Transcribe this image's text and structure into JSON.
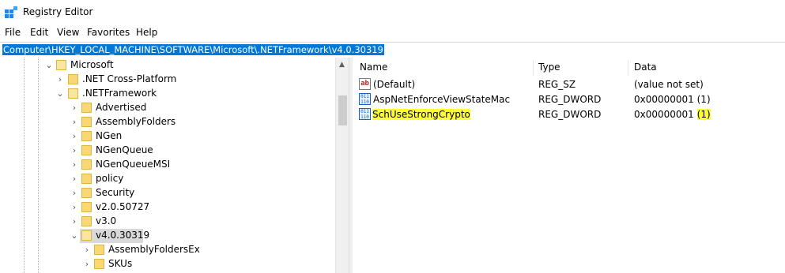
{
  "window": {
    "title": "Registry Editor",
    "icon": "registry-editor-icon"
  },
  "menu": {
    "items": [
      "File",
      "Edit",
      "View",
      "Favorites",
      "Help"
    ]
  },
  "address": {
    "path": "Computer\\HKEY_LOCAL_MACHINE\\SOFTWARE\\Microsoft\\.NETFramework\\v4.0.30319"
  },
  "tree": {
    "nodes": [
      {
        "label": "Microsoft",
        "state": "expanded"
      },
      {
        "label": ".NET Cross-Platform",
        "state": "collapsed"
      },
      {
        "label": ".NETFramework",
        "state": "expanded"
      },
      {
        "label": "Advertised",
        "state": "collapsed"
      },
      {
        "label": "AssemblyFolders",
        "state": "collapsed"
      },
      {
        "label": "NGen",
        "state": "collapsed"
      },
      {
        "label": "NGenQueue",
        "state": "collapsed"
      },
      {
        "label": "NGenQueueMSI",
        "state": "collapsed"
      },
      {
        "label": "policy",
        "state": "collapsed"
      },
      {
        "label": "Security",
        "state": "collapsed"
      },
      {
        "label": "v2.0.50727",
        "state": "collapsed"
      },
      {
        "label": "v3.0",
        "state": "collapsed"
      },
      {
        "label": "v4.0.30319",
        "state": "expanded",
        "selected": true
      },
      {
        "label": "AssemblyFoldersEx",
        "state": "collapsed"
      },
      {
        "label": "SKUs",
        "state": "collapsed"
      }
    ]
  },
  "list": {
    "columns": [
      "Name",
      "Type",
      "Data"
    ],
    "rows": [
      {
        "icon": "string-value-icon",
        "name": "(Default)",
        "type": "REG_SZ",
        "data": "(value not set)",
        "highlighted": false
      },
      {
        "icon": "dword-value-icon",
        "name": "AspNetEnforceViewStateMac",
        "type": "REG_DWORD",
        "data": "0x00000001 (1)",
        "highlighted": false
      },
      {
        "icon": "dword-value-icon",
        "name": "SchUseStrongCrypto",
        "type": "REG_DWORD",
        "data_hex": "0x00000001",
        "data_dec": "(1)",
        "highlighted": true
      }
    ]
  },
  "colors": {
    "selection": "#0078d7",
    "highlight": "#ffff33",
    "folder": "#f8d775"
  }
}
